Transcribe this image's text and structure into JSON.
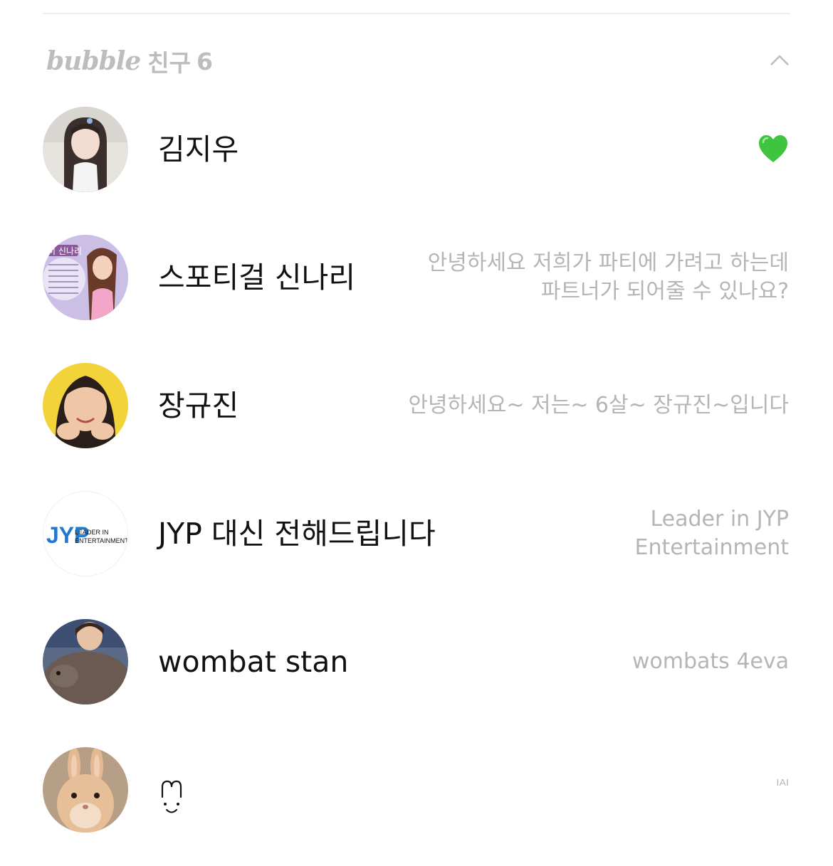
{
  "section": {
    "brand": "bubble",
    "label": "친구",
    "count": "6"
  },
  "friends": [
    {
      "name": "김지우",
      "status_icon": "green-heart-icon",
      "status_lines": []
    },
    {
      "name": "스포티걸 신나리",
      "status_lines": [
        "안녕하세요 저희가 파티에 가려고 하는데",
        "파트너가 되어줄 수 있나요?"
      ],
      "avatar_logo_text": [
        "미 신나리"
      ]
    },
    {
      "name": "장규진",
      "status_lines": [
        "안녕하세요~ 저는~ 6살~ 장규진~입니다"
      ]
    },
    {
      "name": "JYP 대신 전해드립니다",
      "status_lines": [
        "Leader in JYP",
        "Entertainment"
      ],
      "avatar_logo_text": [
        "JYP",
        "LEADER IN",
        "ENTERTAINMENT"
      ]
    },
    {
      "name": "wombat stan",
      "status_lines": [
        "wombats 4eva"
      ]
    },
    {
      "name": "",
      "name_icon": "smiley-scribble-icon",
      "status_lines": [
        "ᴵᴬᴵ"
      ]
    }
  ],
  "colors": {
    "muted_text": "#b5b5b5",
    "name_text": "#111111",
    "heart": "#3fc43f"
  }
}
